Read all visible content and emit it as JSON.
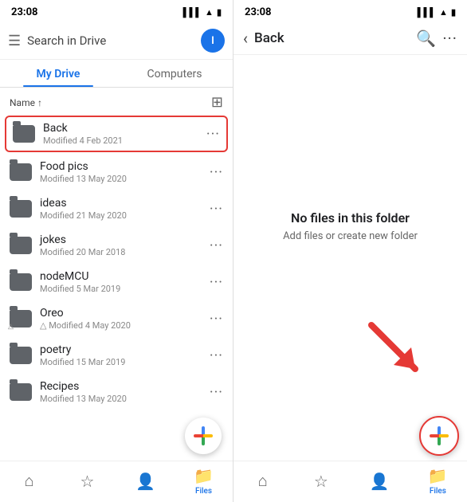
{
  "left_panel": {
    "status_time": "23:08",
    "search_placeholder": "Search in Drive",
    "avatar_letter": "I",
    "tabs": [
      {
        "label": "My Drive",
        "active": true
      },
      {
        "label": "Computers",
        "active": false
      }
    ],
    "list_header": {
      "name_label": "Name",
      "sort_arrow": "↑"
    },
    "files": [
      {
        "name": "Back",
        "meta": "Modified 4 Feb 2021",
        "highlighted": true
      },
      {
        "name": "Food pics",
        "meta": "Modified 13 May 2020",
        "highlighted": false
      },
      {
        "name": "ideas",
        "meta": "Modified 21 May 2020",
        "highlighted": false
      },
      {
        "name": "jokes",
        "meta": "Modified 20 Mar 2018",
        "highlighted": false
      },
      {
        "name": "nodeMCU",
        "meta": "Modified 5 Mar 2019",
        "highlighted": false
      },
      {
        "name": "Oreo",
        "meta": "Modified 4 May 2020",
        "highlighted": false,
        "shared": true
      },
      {
        "name": "poetry",
        "meta": "Modified 15 Mar 2019",
        "highlighted": false
      },
      {
        "name": "Recipes",
        "meta": "Modified 13 May 2020",
        "highlighted": false
      }
    ],
    "nav_items": [
      {
        "icon": "⌂",
        "label": "",
        "active": false
      },
      {
        "icon": "☆",
        "label": "",
        "active": false
      },
      {
        "icon": "👤",
        "label": "",
        "active": false
      },
      {
        "icon": "📁",
        "label": "Files",
        "active": true
      }
    ]
  },
  "right_panel": {
    "status_time": "23:08",
    "back_label": "Back",
    "empty_title": "No files in this folder",
    "empty_subtitle": "Add files or create new folder",
    "nav_items": [
      {
        "icon": "⌂",
        "label": "",
        "active": false
      },
      {
        "icon": "☆",
        "label": "",
        "active": false
      },
      {
        "icon": "👤",
        "label": "",
        "active": false
      },
      {
        "icon": "📁",
        "label": "Files",
        "active": true
      }
    ]
  }
}
